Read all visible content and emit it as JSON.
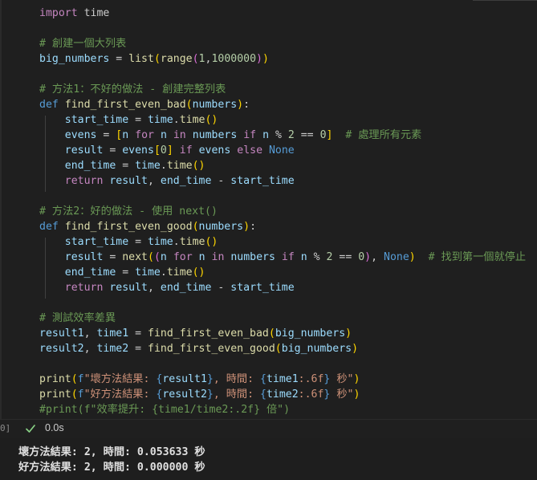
{
  "cell": {
    "execution_count": "0]",
    "duration": "0.0s",
    "status_icon": "check-icon",
    "status_color": "#89d185"
  },
  "code": {
    "lines": [
      [
        [
          "import",
          "ctrl"
        ],
        [
          " time",
          "def"
        ]
      ],
      [],
      [
        [
          "# 創建一個大列表",
          "cmt"
        ]
      ],
      [
        [
          "big_numbers",
          "var"
        ],
        [
          " = ",
          "def"
        ],
        [
          "list",
          "fn"
        ],
        [
          "(",
          "b1"
        ],
        [
          "range",
          "fn"
        ],
        [
          "(",
          "b2"
        ],
        [
          "1",
          "num"
        ],
        [
          ",",
          "def"
        ],
        [
          "1000000",
          "num"
        ],
        [
          ")",
          "b2"
        ],
        [
          ")",
          "b1"
        ]
      ],
      [],
      [
        [
          "# 方法1：不好的做法 - 創建完整列表",
          "cmt"
        ]
      ],
      [
        [
          "def",
          "kw"
        ],
        [
          " ",
          "def"
        ],
        [
          "find_first_even_bad",
          "fn"
        ],
        [
          "(",
          "b1"
        ],
        [
          "numbers",
          "var"
        ],
        [
          ")",
          "b1"
        ],
        [
          ":",
          "def"
        ]
      ],
      [
        [
          "    start_time",
          "var"
        ],
        [
          " = ",
          "def"
        ],
        [
          "time",
          "var"
        ],
        [
          ".",
          "def"
        ],
        [
          "time",
          "fn"
        ],
        [
          "(",
          "b1"
        ],
        [
          ")",
          "b1"
        ]
      ],
      [
        [
          "    evens",
          "var"
        ],
        [
          " = ",
          "def"
        ],
        [
          "[",
          "b1"
        ],
        [
          "n",
          "var"
        ],
        [
          " ",
          "def"
        ],
        [
          "for",
          "ctrl"
        ],
        [
          " ",
          "def"
        ],
        [
          "n",
          "var"
        ],
        [
          " ",
          "def"
        ],
        [
          "in",
          "ctrl"
        ],
        [
          " ",
          "def"
        ],
        [
          "numbers",
          "var"
        ],
        [
          " ",
          "def"
        ],
        [
          "if",
          "ctrl"
        ],
        [
          " ",
          "def"
        ],
        [
          "n",
          "var"
        ],
        [
          " % ",
          "def"
        ],
        [
          "2",
          "num"
        ],
        [
          " == ",
          "def"
        ],
        [
          "0",
          "num"
        ],
        [
          "]",
          "b1"
        ],
        [
          "  ",
          "def"
        ],
        [
          "# 處理所有元素",
          "cmt"
        ]
      ],
      [
        [
          "    result",
          "var"
        ],
        [
          " = ",
          "def"
        ],
        [
          "evens",
          "var"
        ],
        [
          "[",
          "b1"
        ],
        [
          "0",
          "num"
        ],
        [
          "]",
          "b1"
        ],
        [
          " ",
          "def"
        ],
        [
          "if",
          "ctrl"
        ],
        [
          " ",
          "def"
        ],
        [
          "evens",
          "var"
        ],
        [
          " ",
          "def"
        ],
        [
          "else",
          "ctrl"
        ],
        [
          " ",
          "def"
        ],
        [
          "None",
          "kw"
        ]
      ],
      [
        [
          "    end_time",
          "var"
        ],
        [
          " = ",
          "def"
        ],
        [
          "time",
          "var"
        ],
        [
          ".",
          "def"
        ],
        [
          "time",
          "fn"
        ],
        [
          "(",
          "b1"
        ],
        [
          ")",
          "b1"
        ]
      ],
      [
        [
          "    return",
          "ctrl"
        ],
        [
          " ",
          "def"
        ],
        [
          "result",
          "var"
        ],
        [
          ", ",
          "def"
        ],
        [
          "end_time",
          "var"
        ],
        [
          " - ",
          "def"
        ],
        [
          "start_time",
          "var"
        ]
      ],
      [],
      [
        [
          "# 方法2：好的做法 - 使用 next()",
          "cmt"
        ]
      ],
      [
        [
          "def",
          "kw"
        ],
        [
          " ",
          "def"
        ],
        [
          "find_first_even_good",
          "fn"
        ],
        [
          "(",
          "b1"
        ],
        [
          "numbers",
          "var"
        ],
        [
          ")",
          "b1"
        ],
        [
          ":",
          "def"
        ]
      ],
      [
        [
          "    start_time",
          "var"
        ],
        [
          " = ",
          "def"
        ],
        [
          "time",
          "var"
        ],
        [
          ".",
          "def"
        ],
        [
          "time",
          "fn"
        ],
        [
          "(",
          "b1"
        ],
        [
          ")",
          "b1"
        ]
      ],
      [
        [
          "    result",
          "var"
        ],
        [
          " = ",
          "def"
        ],
        [
          "next",
          "fn"
        ],
        [
          "(",
          "b1"
        ],
        [
          "(",
          "b2"
        ],
        [
          "n",
          "var"
        ],
        [
          " ",
          "def"
        ],
        [
          "for",
          "ctrl"
        ],
        [
          " ",
          "def"
        ],
        [
          "n",
          "var"
        ],
        [
          " ",
          "def"
        ],
        [
          "in",
          "ctrl"
        ],
        [
          " ",
          "def"
        ],
        [
          "numbers",
          "var"
        ],
        [
          " ",
          "def"
        ],
        [
          "if",
          "ctrl"
        ],
        [
          " ",
          "def"
        ],
        [
          "n",
          "var"
        ],
        [
          " % ",
          "def"
        ],
        [
          "2",
          "num"
        ],
        [
          " == ",
          "def"
        ],
        [
          "0",
          "num"
        ],
        [
          ")",
          "b2"
        ],
        [
          ", ",
          "def"
        ],
        [
          "None",
          "kw"
        ],
        [
          ")",
          "b1"
        ],
        [
          "  ",
          "def"
        ],
        [
          "# 找到第一個就停止",
          "cmt"
        ]
      ],
      [
        [
          "    end_time",
          "var"
        ],
        [
          " = ",
          "def"
        ],
        [
          "time",
          "var"
        ],
        [
          ".",
          "def"
        ],
        [
          "time",
          "fn"
        ],
        [
          "(",
          "b1"
        ],
        [
          ")",
          "b1"
        ]
      ],
      [
        [
          "    return",
          "ctrl"
        ],
        [
          " ",
          "def"
        ],
        [
          "result",
          "var"
        ],
        [
          ", ",
          "def"
        ],
        [
          "end_time",
          "var"
        ],
        [
          " - ",
          "def"
        ],
        [
          "start_time",
          "var"
        ]
      ],
      [],
      [
        [
          "# 測試效率差異",
          "cmt"
        ]
      ],
      [
        [
          "result1",
          "var"
        ],
        [
          ", ",
          "def"
        ],
        [
          "time1",
          "var"
        ],
        [
          " = ",
          "def"
        ],
        [
          "find_first_even_bad",
          "fn"
        ],
        [
          "(",
          "b1"
        ],
        [
          "big_numbers",
          "var"
        ],
        [
          ")",
          "b1"
        ]
      ],
      [
        [
          "result2",
          "var"
        ],
        [
          ", ",
          "def"
        ],
        [
          "time2",
          "var"
        ],
        [
          " = ",
          "def"
        ],
        [
          "find_first_even_good",
          "fn"
        ],
        [
          "(",
          "b1"
        ],
        [
          "big_numbers",
          "var"
        ],
        [
          ")",
          "b1"
        ]
      ],
      [],
      [
        [
          "print",
          "fn"
        ],
        [
          "(",
          "b1"
        ],
        [
          "f",
          "kw"
        ],
        [
          "\"壞方法結果: ",
          "str"
        ],
        [
          "{",
          "esc"
        ],
        [
          "result1",
          "var"
        ],
        [
          "}",
          "esc"
        ],
        [
          ", 時間: ",
          "str"
        ],
        [
          "{",
          "esc"
        ],
        [
          "time1",
          "var"
        ],
        [
          ":.6f",
          "str"
        ],
        [
          "}",
          "esc"
        ],
        [
          " 秒\"",
          "str"
        ],
        [
          ")",
          "b1"
        ]
      ],
      [
        [
          "print",
          "fn"
        ],
        [
          "(",
          "b1"
        ],
        [
          "f",
          "kw"
        ],
        [
          "\"好方法結果: ",
          "str"
        ],
        [
          "{",
          "esc"
        ],
        [
          "result2",
          "var"
        ],
        [
          "}",
          "esc"
        ],
        [
          ", 時間: ",
          "str"
        ],
        [
          "{",
          "esc"
        ],
        [
          "time2",
          "var"
        ],
        [
          ":.6f",
          "str"
        ],
        [
          "}",
          "esc"
        ],
        [
          " 秒\"",
          "str"
        ],
        [
          ")",
          "b1"
        ]
      ],
      [
        [
          "#print(f\"效率提升: {time1/time2:.2f} 倍\")",
          "cmt"
        ]
      ]
    ]
  },
  "output": {
    "line1": "壞方法結果: 2, 時間: 0.053633 秒",
    "line2": "好方法結果: 2, 時間: 0.000000 秒"
  }
}
